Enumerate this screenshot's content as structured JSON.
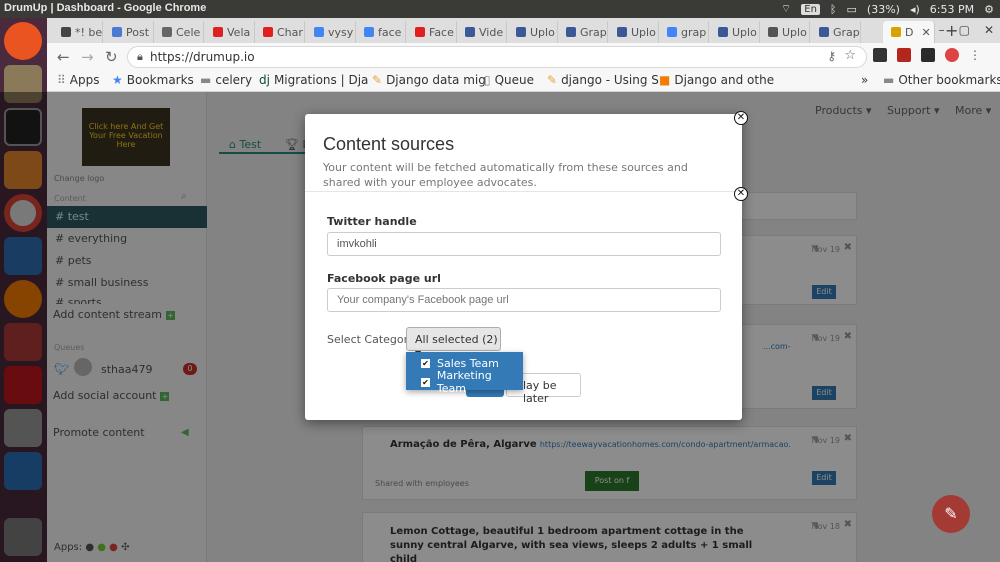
{
  "os": {
    "window_title": "DrumUp | Dashboard - Google Chrome",
    "keyboard": "En",
    "battery": "(33%)",
    "clock": "6:53 PM"
  },
  "browser": {
    "tabs": [
      {
        "label": "*! be",
        "color": "#444"
      },
      {
        "label": "Post",
        "color": "#4a7bd0"
      },
      {
        "label": "Cele",
        "color": "#666"
      },
      {
        "label": "Vela",
        "color": "#e02020"
      },
      {
        "label": "Char",
        "color": "#e02020"
      },
      {
        "label": "vysy",
        "color": "#4285f4"
      },
      {
        "label": "face",
        "color": "#4285f4"
      },
      {
        "label": "Face",
        "color": "#e02020"
      },
      {
        "label": "Vide",
        "color": "#3b5998"
      },
      {
        "label": "Uplo",
        "color": "#3b5998"
      },
      {
        "label": "Grap",
        "color": "#3b5998"
      },
      {
        "label": "Uplo",
        "color": "#3b5998"
      },
      {
        "label": "grap",
        "color": "#4285f4"
      },
      {
        "label": "Uplo",
        "color": "#3b5998"
      },
      {
        "label": "Uplo",
        "color": "#555"
      },
      {
        "label": "Grap",
        "color": "#3b5998"
      },
      {
        "label": "D",
        "color": "#d4a500"
      }
    ],
    "url": "https://drumup.io",
    "bookmarks": [
      "Apps",
      "Bookmarks",
      "celery",
      "Migrations | Dja",
      "Django data mig",
      "Queue",
      "django - Using S",
      "Django and othe",
      "»",
      "Other bookmarks"
    ]
  },
  "sidebar": {
    "thumb_text": "Click here And Get Your Free Vacation Here",
    "change_logo": "Change logo",
    "content_label": "Content",
    "streams": [
      "test",
      "everything",
      "pets",
      "small business",
      "sports"
    ],
    "add_stream": "Add content stream",
    "queues_label": "Queues",
    "account": "sthaa479",
    "account_count": "0",
    "add_social": "Add social account",
    "promote": "Promote content",
    "apps": "Apps:"
  },
  "main": {
    "tabs": [
      "Test",
      "Le"
    ],
    "menus": [
      "Products ▾",
      "Support ▾",
      "More ▾"
    ],
    "cards": [
      {
        "date": "Nov 19"
      },
      {
        "date": "Nov 19",
        "link": "...com-"
      },
      {
        "date": "Nov 19",
        "title": "Armação de Pêra, Algarve",
        "link": "https://teewayvacationhomes.com/condo-apartment/armacao...",
        "shared": "Shared with employees",
        "post": "Post on f"
      },
      {
        "date": "Nov 18",
        "title": "Lemon Cottage, beautiful 1 bedroom apartment cottage in the sunny central Algarve, with sea views, sleeps 2 adults + 1 small child"
      }
    ],
    "edit_label": "Edit"
  },
  "modal": {
    "title": "Content sources",
    "description": "Your content will be fetched automatically from these sources and shared with your employee advocates.",
    "twitter_label": "Twitter handle",
    "twitter_value": "imvkohli",
    "facebook_label": "Facebook page url",
    "facebook_placeholder": "Your company's Facebook page url",
    "category_label": "Select Category:",
    "category_selected": "All selected (2)",
    "options": [
      "Sales Team",
      "Marketing Team"
    ],
    "later_button": "lay be later"
  }
}
